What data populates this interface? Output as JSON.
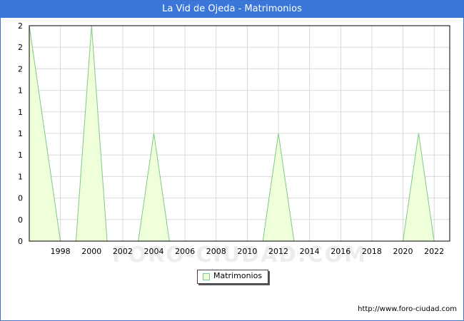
{
  "header": {
    "title": "La Vid de Ojeda - Matrimonios"
  },
  "watermark": "FORO-CIUDAD.COM",
  "footer": {
    "source": "http://www.foro-ciudad.com"
  },
  "colors": {
    "title_bar": "#3a77d8",
    "series_line": "#7fc98a",
    "series_fill": "#eeffd9",
    "grid": "#d9d9d9"
  },
  "chart_data": {
    "type": "area",
    "title": "La Vid de Ojeda - Matrimonios",
    "x": [
      1996,
      1997,
      1998,
      1999,
      2000,
      2001,
      2002,
      2003,
      2004,
      2005,
      2006,
      2007,
      2008,
      2009,
      2010,
      2011,
      2012,
      2013,
      2014,
      2015,
      2016,
      2017,
      2018,
      2019,
      2020,
      2021,
      2022
    ],
    "series": [
      {
        "name": "Matrimonios",
        "values": [
          2,
          1,
          0,
          0,
          2,
          0,
          0,
          0,
          1,
          0,
          0,
          0,
          0,
          0,
          0,
          0,
          1,
          0,
          0,
          0,
          0,
          0,
          0,
          0,
          0,
          1,
          0
        ]
      }
    ],
    "xticks": [
      1998,
      2000,
      2002,
      2004,
      2006,
      2008,
      2010,
      2012,
      2014,
      2016,
      2018,
      2020,
      2022
    ],
    "yticks": [
      0,
      0.2,
      0.4,
      0.6,
      0.8,
      1,
      1.2,
      1.4,
      1.6,
      1.8,
      2
    ],
    "ytick_labels": [
      "0",
      "0",
      "0",
      "1",
      "1",
      "1",
      "1",
      "1",
      "2",
      "2",
      "2"
    ],
    "xlim": [
      1996,
      2023
    ],
    "ylim": [
      0,
      2
    ],
    "grid": true,
    "legend": {
      "position": "bottom-center",
      "label": "Matrimonios"
    },
    "xlabel": "",
    "ylabel": ""
  }
}
